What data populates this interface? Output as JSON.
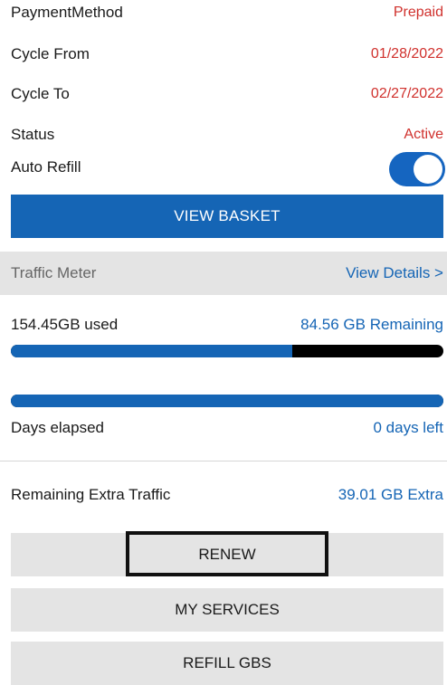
{
  "account": {
    "payment_method_label": "PaymentMethod",
    "payment_method_value": "Prepaid",
    "cycle_from_label": "Cycle From",
    "cycle_from_value": "01/28/2022",
    "cycle_to_label": "Cycle To",
    "cycle_to_value": "02/27/2022",
    "status_label": "Status",
    "status_value": "Active",
    "auto_refill_label": "Auto Refill",
    "auto_refill_on": true
  },
  "actions": {
    "view_basket_label": "VIEW BASKET"
  },
  "traffic_meter": {
    "title": "Traffic Meter",
    "view_details_label": "View Details >",
    "used_text": "154.45GB used",
    "remaining_text": "84.56 GB Remaining",
    "usage_fraction": 0.65,
    "days_elapsed_label": "Days elapsed",
    "days_left_text": "0 days left",
    "days_fraction": 1.0
  },
  "extra_traffic": {
    "label": "Remaining Extra Traffic",
    "value": "39.01 GB Extra"
  },
  "buttons": {
    "renew_label": "RENEW",
    "my_services_label": "MY SERVICES",
    "refill_gbs_label": "REFILL GBS"
  },
  "colors": {
    "accent_blue": "#1565b5",
    "status_red": "#d0312d",
    "panel_gray": "#e4e4e4"
  }
}
